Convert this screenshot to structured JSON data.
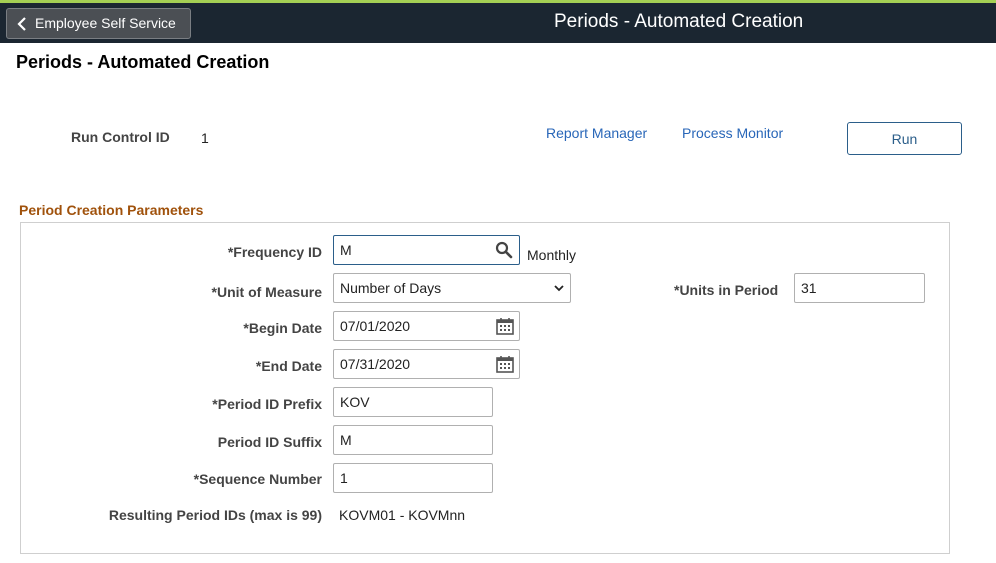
{
  "header": {
    "back_label": "Employee Self Service",
    "title": "Periods - Automated Creation"
  },
  "page": {
    "title": "Periods - Automated Creation"
  },
  "run_control": {
    "label": "Run Control ID",
    "value": "1",
    "report_manager": "Report Manager",
    "process_monitor": "Process Monitor",
    "run_label": "Run"
  },
  "section": {
    "title": "Period Creation Parameters",
    "frequency": {
      "label": "*Frequency ID",
      "value": "M",
      "description": "Monthly"
    },
    "unit_of_measure": {
      "label": "*Unit of Measure",
      "value": "Number of Days"
    },
    "units_in_period": {
      "label": "*Units in Period",
      "value": "31"
    },
    "begin_date": {
      "label": "*Begin Date",
      "value": "07/01/2020"
    },
    "end_date": {
      "label": "*End Date",
      "value": "07/31/2020"
    },
    "prefix": {
      "label": "*Period ID Prefix",
      "value": "KOV"
    },
    "suffix": {
      "label": "Period ID Suffix",
      "value": "M"
    },
    "sequence": {
      "label": "*Sequence Number",
      "value": "1"
    },
    "resulting": {
      "label": "Resulting Period IDs (max is 99)",
      "value": "KOVM01 - KOVMnn"
    }
  },
  "colors": {
    "header_bg": "#1b2631",
    "accent": "#a4cf54",
    "section_title": "#a0520c",
    "link": "#2866b8"
  }
}
